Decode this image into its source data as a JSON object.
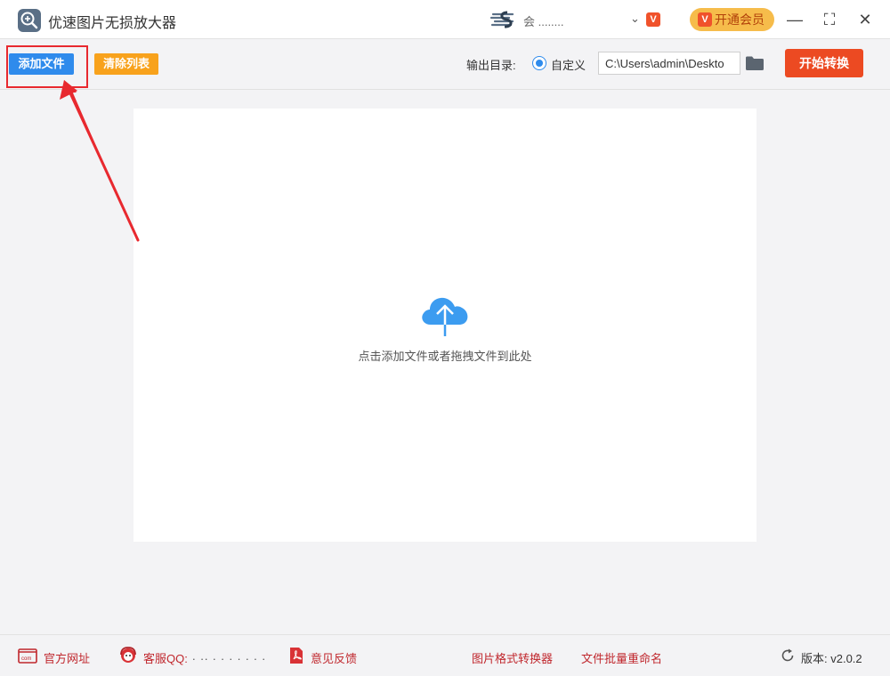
{
  "titlebar": {
    "app_title": "优速图片无损放大器",
    "user_name": "会 ........",
    "user_badge": "V",
    "vip_label": "开通会员",
    "minimize": "—",
    "maximize": "⛶",
    "close": "✕"
  },
  "toolbar": {
    "add_label": "添加文件",
    "clear_label": "清除列表",
    "output_label": "输出目录:",
    "radio_label": "自定义",
    "output_path": "C:\\Users\\admin\\Deskto",
    "start_label": "开始转换"
  },
  "drop": {
    "hint": "点击添加文件或者拖拽文件到此处"
  },
  "footer": {
    "website": "官方网址",
    "qq_label": "客服QQ:",
    "qq_number": ". .. . . . . . . .",
    "feedback": "意见反馈",
    "converter": "图片格式转换器",
    "rename": "文件批量重命名",
    "version": "版本: v2.0.2"
  },
  "colors": {
    "add_button": "#2f8bec",
    "clear_button": "#f8a21c",
    "start_button": "#ec4a22",
    "vip_button": "#f6bc4b",
    "annotation": "#e8292f"
  },
  "icons": [
    "app-logo-icon",
    "user-logo-icon",
    "chevron-down-icon",
    "folder-icon",
    "cloud-upload-icon",
    "web-icon",
    "customer-service-icon",
    "pdf-feedback-icon",
    "refresh-icon"
  ]
}
